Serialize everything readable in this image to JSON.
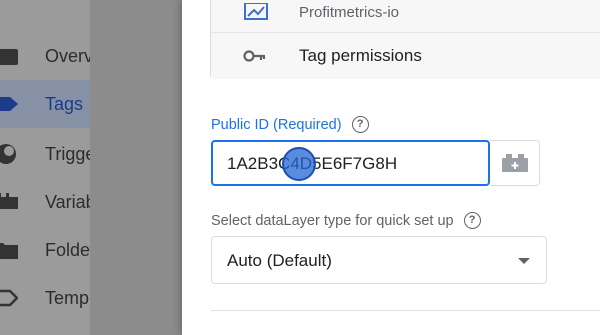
{
  "sidebar": {
    "items": [
      {
        "label": "Overv",
        "icon": "folder-icon",
        "active": false
      },
      {
        "label": "Tags",
        "icon": "tag-icon",
        "active": true
      },
      {
        "label": "Trigge",
        "icon": "trigger-icon",
        "active": false
      },
      {
        "label": "Variab",
        "icon": "variable-icon",
        "active": false
      },
      {
        "label": "Folde",
        "icon": "folder-icon",
        "active": false
      },
      {
        "label": "Temp",
        "icon": "template-icon",
        "active": false
      }
    ]
  },
  "card": {
    "items": [
      {
        "label": "Profitmetrics-io",
        "icon": "chart-icon"
      },
      {
        "label": "Tag permissions",
        "icon": "key-icon"
      }
    ]
  },
  "public_id": {
    "label": "Public ID (Required)",
    "value": "1A2B3C4D5E6F7G8H",
    "help_icon": "help-icon",
    "variable_button_icon": "variable-picker-icon"
  },
  "datalayer": {
    "label": "Select dataLayer type for quick set up",
    "selected": "Auto (Default)",
    "help_icon": "help-icon"
  },
  "colors": {
    "accent": "#1a73e8",
    "text": "#202124",
    "muted": "#5f6368"
  }
}
